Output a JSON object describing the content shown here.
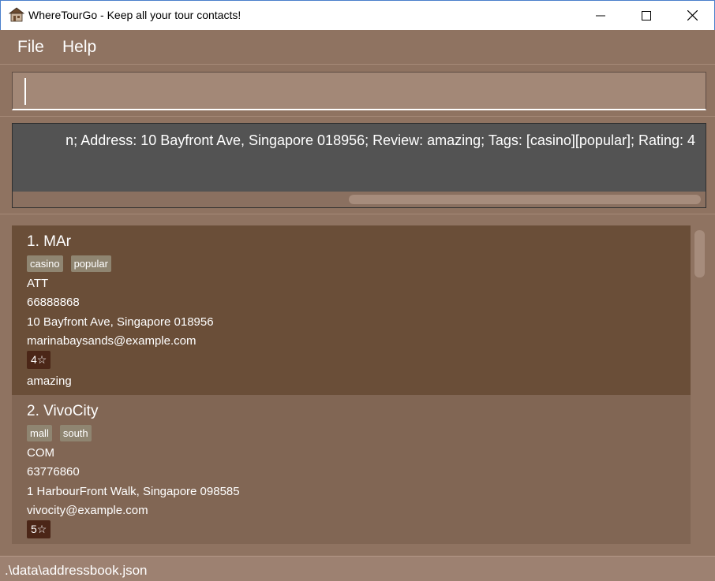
{
  "window": {
    "title": "WhereTourGo - Keep all your tour contacts!",
    "controls": [
      "minimize-icon",
      "maximize-icon",
      "close-icon"
    ]
  },
  "menu": {
    "file": "File",
    "help": "Help"
  },
  "command": {
    "value": ""
  },
  "result": {
    "text": "n; Address: 10 Bayfront Ave, Singapore 018956; Review: amazing; Tags: [casino][popular]; Rating: 4"
  },
  "contacts": [
    {
      "title": "1.  MAr",
      "tags": [
        "casino",
        "popular"
      ],
      "category": "ATT",
      "phone": "66888868",
      "address": "10 Bayfront Ave, Singapore 018956",
      "email": "marinabaysands@example.com",
      "rating": "4☆",
      "review": "amazing"
    },
    {
      "title": "2.  VivoCity",
      "tags": [
        "mall",
        "south"
      ],
      "category": "COM",
      "phone": "63776860",
      "address": "1 HarbourFront Walk, Singapore 098585",
      "email": "vivocity@example.com",
      "rating": "5☆"
    }
  ],
  "status": {
    "path": ".\\data\\addressbook.json"
  }
}
